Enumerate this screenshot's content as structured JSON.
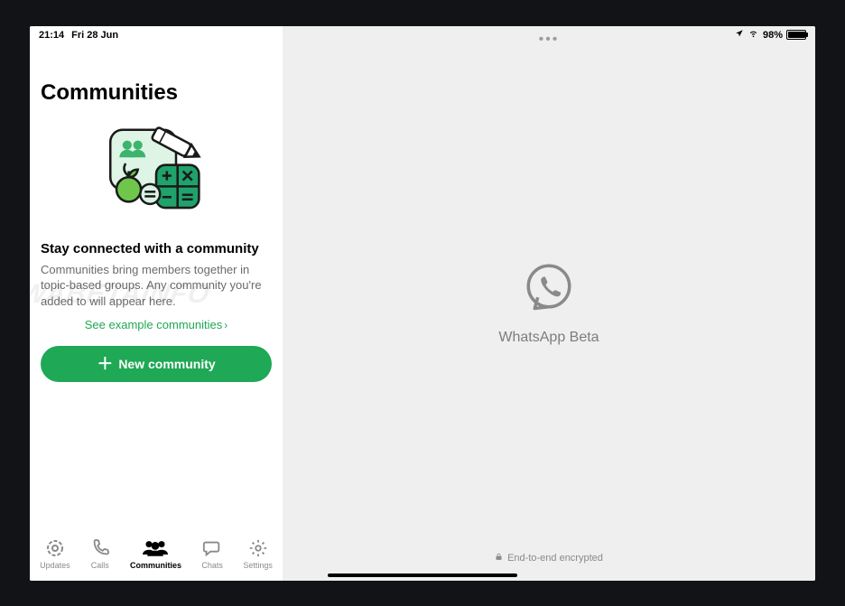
{
  "status": {
    "time": "21:14",
    "date": "Fri 28 Jun",
    "battery_pct": "98%"
  },
  "left": {
    "title": "Communities",
    "subhead": "Stay connected with a community",
    "body": "Communities bring members together in topic-based groups. Any community you're added to will appear here.",
    "example_link": "See example communities",
    "new_btn": "New community"
  },
  "tabs": {
    "updates": "Updates",
    "calls": "Calls",
    "communities": "Communities",
    "chats": "Chats",
    "settings": "Settings"
  },
  "right": {
    "app_name": "WhatsApp Beta",
    "encrypted": "End-to-end encrypted"
  }
}
